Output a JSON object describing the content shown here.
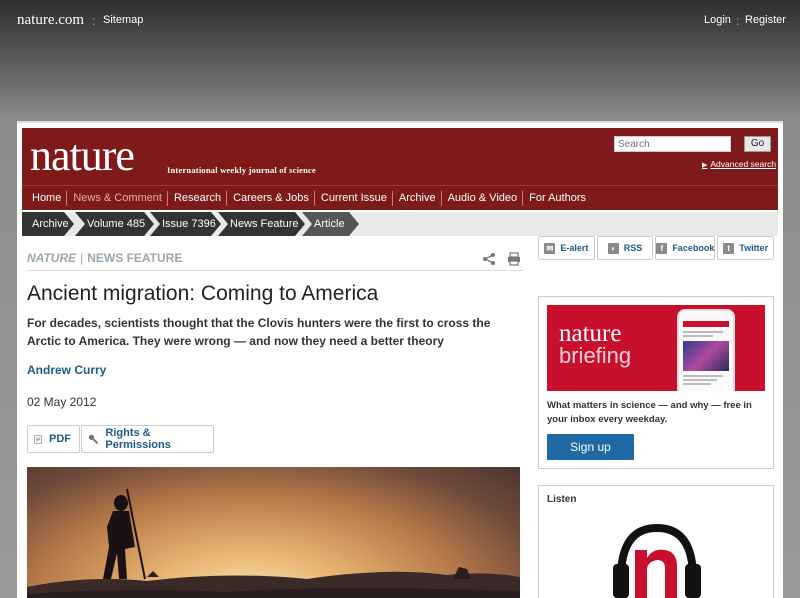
{
  "top": {
    "brand": "nature.com",
    "sitemap": "Sitemap",
    "login": "Login",
    "register": "Register",
    "sep": ":"
  },
  "masthead": {
    "logo": "nature",
    "tagline": "International weekly journal of science",
    "search_placeholder": "Search",
    "go_label": "Go",
    "advanced_search": "Advanced search"
  },
  "nav": {
    "items": [
      "Home",
      "News & Comment",
      "Research",
      "Careers & Jobs",
      "Current Issue",
      "Archive",
      "Audio & Video",
      "For Authors"
    ]
  },
  "breadcrumb": [
    "Archive",
    "Volume 485",
    "Issue 7396",
    "News Feature",
    "Article"
  ],
  "article": {
    "journal": "NATURE",
    "sep": "|",
    "section": "NEWS FEATURE",
    "headline": "Ancient migration: Coming to America",
    "standfirst": "For decades, scientists thought that the Clovis hunters were the first to cross the Arctic to America. They were wrong — and now they need a better theory",
    "author": "Andrew Curry",
    "date": "02 May 2012",
    "pdf_label": "PDF",
    "rights_label": "Rights & Permissions"
  },
  "social": [
    {
      "label": "E-alert",
      "icon": "mail-icon"
    },
    {
      "label": "RSS",
      "icon": "rss-icon"
    },
    {
      "label": "Facebook",
      "icon": "facebook-icon"
    },
    {
      "label": "Twitter",
      "icon": "twitter-icon"
    }
  ],
  "briefing": {
    "img_line1": "nature",
    "img_line2": "briefing",
    "text": "What matters in science — and why — free in your inbox every weekday.",
    "signup": "Sign up"
  },
  "listen": {
    "title": "Listen"
  },
  "colors": {
    "brand_red": "#7f1a1a",
    "link_blue": "#1b5b86",
    "signup_blue": "#1f6aa5",
    "briefing_red": "#c8102e"
  }
}
